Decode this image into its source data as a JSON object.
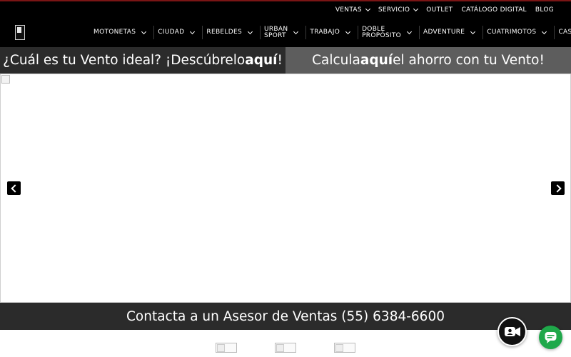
{
  "top_nav": {
    "items": [
      {
        "label": "VENTAS",
        "has_dropdown": true
      },
      {
        "label": "SERVICIO",
        "has_dropdown": true
      },
      {
        "label": "OUTLET",
        "has_dropdown": false
      },
      {
        "label": "CATÁLOGO DIGITAL",
        "has_dropdown": false
      },
      {
        "label": "BLOG",
        "has_dropdown": false
      }
    ]
  },
  "main_nav": {
    "items": [
      {
        "label": "MOTONETAS",
        "label2": "",
        "has_dropdown": true
      },
      {
        "label": "CIUDAD",
        "label2": "",
        "has_dropdown": true
      },
      {
        "label": "REBELDES",
        "label2": "",
        "has_dropdown": true
      },
      {
        "label": "URBAN",
        "label2": "SPORT",
        "has_dropdown": true
      },
      {
        "label": "TRABAJO",
        "label2": "",
        "has_dropdown": true
      },
      {
        "label": "DOBLE",
        "label2": "PROPÓSITO",
        "has_dropdown": true
      },
      {
        "label": "ADVENTURE",
        "label2": "",
        "has_dropdown": true
      },
      {
        "label": "CUATRIMOTOS",
        "label2": "",
        "has_dropdown": true
      },
      {
        "label": "CASCOS",
        "label2": "",
        "has_dropdown": false
      }
    ]
  },
  "promo": {
    "left_prefix": "¿Cuál es tu Vento ideal? ¡Descúbrelo ",
    "left_bold": "aquí",
    "left_suffix": "!",
    "right_prefix": "Calcula ",
    "right_bold": "aquí",
    "right_suffix": " el ahorro con tu Vento!"
  },
  "contact": {
    "text": "Contacta a un Asesor de Ventas (55) 6384-6600"
  },
  "colors": {
    "nav_bg": "#000000",
    "promo_left_bg": "#2b2b2b",
    "promo_right_bg": "#5d5d5d",
    "chat_green": "#1fa84a"
  },
  "icons": {
    "prev": "chevron-left-icon",
    "next": "chevron-right-icon",
    "video": "video-call-icon",
    "chat": "chat-bubble-icon"
  }
}
